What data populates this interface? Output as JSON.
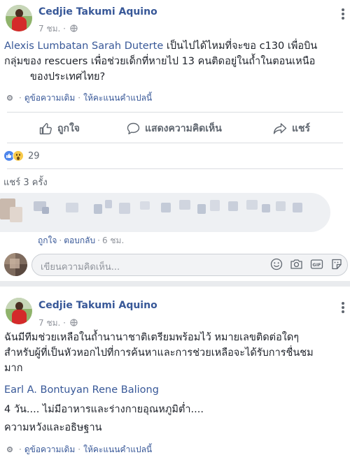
{
  "colors": {
    "link": "#385898",
    "text": "#1d2129",
    "muted": "#90949c",
    "action": "#606770",
    "like_reaction": "#4e86ec",
    "wow_reaction": "#f7c94a"
  },
  "post1": {
    "author": "Cedjie Takumi Aquino",
    "time": "7 ชม.",
    "privacy_icon": "globe-icon",
    "tags_line": "Alexis Lumbatan Sarah Duterte",
    "text_line1_rest": " เป็นไปได้ไหมที่จะขอ c130 เพื่อบิน",
    "text_line2": "กลุ่มของ rescuers เพื่อช่วยเด็กที่หายไป 13 คนติดอยู่ในถ้ำในตอนเหนือ",
    "text_line3": "ของประเทศไทย?",
    "see_original": "ดูข้อความเดิม",
    "rate_translation": "ให้คะแนนคำแปลนี้",
    "actions": {
      "like": "ถูกใจ",
      "comment": "แสดงความคิดเห็น",
      "share": "แชร์"
    },
    "reaction_icons": [
      "like-reaction-icon",
      "wow-reaction-icon"
    ],
    "reaction_count": "29",
    "shares": "แชร์ 3 ครั้ง",
    "comment_actions": {
      "like": "ถูกใจ",
      "reply": "ตอบกลับ",
      "time": "6 ชม."
    },
    "comment_placeholder": "เขียนความคิดเห็น...",
    "comment_box_icons": [
      "emoji-icon",
      "camera-icon",
      "gif-icon",
      "sticker-icon"
    ]
  },
  "post2": {
    "author": "Cedjie Takumi Aquino",
    "time": "7 ชม.",
    "privacy_icon": "globe-icon",
    "text_line1": "ฉันมีทีมช่วยเหลือในถ้ำนานาชาติเตรียมพร้อมไว้ หมายเลขติดต่อใดๆ",
    "text_line2": "สำหรับผู้ที่เป็นหัวหอกไปที่การค้นหาและการช่วยเหลือจะได้รับการชื่นชม",
    "text_line3": "มาก",
    "tags_line": "Earl A. Bontuyan Rene Baliong",
    "text_line5": "4 วัน.... ไม่มีอาหารและร่างกายอุณหภูมิต่ำ....",
    "text_line6": "ความหวังและอธิษฐาน",
    "see_original": "ดูข้อความเดิม",
    "rate_translation": "ให้คะแนนคำแปลนี้"
  }
}
